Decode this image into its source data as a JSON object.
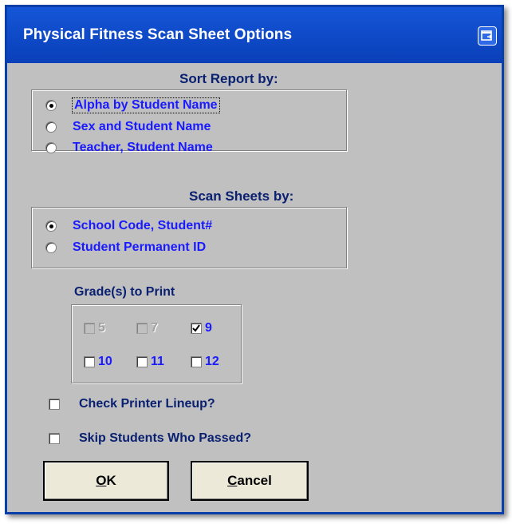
{
  "window": {
    "title": "Physical Fitness Scan Sheet Options"
  },
  "sort_report": {
    "heading": "Sort Report by:",
    "options": [
      {
        "label": "Alpha by Student Name",
        "selected": true
      },
      {
        "label": "Sex and Student Name",
        "selected": false
      },
      {
        "label": "Teacher, Student Name",
        "selected": false
      }
    ]
  },
  "scan_sheets": {
    "heading": "Scan Sheets by:",
    "options": [
      {
        "label": "School Code, Student#",
        "selected": true
      },
      {
        "label": "Student Permanent ID",
        "selected": false
      }
    ]
  },
  "grades": {
    "heading": "Grade(s) to Print",
    "items": [
      {
        "label": "5",
        "checked": false,
        "disabled": true
      },
      {
        "label": "7",
        "checked": false,
        "disabled": true
      },
      {
        "label": "9",
        "checked": true,
        "disabled": false
      },
      {
        "label": "10",
        "checked": false,
        "disabled": false
      },
      {
        "label": "11",
        "checked": false,
        "disabled": false
      },
      {
        "label": "12",
        "checked": false,
        "disabled": false
      }
    ]
  },
  "options": {
    "check_printer_lineup": {
      "label": "Check Printer Lineup?",
      "checked": false
    },
    "skip_passed": {
      "label": "Skip Students Who Passed?",
      "checked": false
    }
  },
  "buttons": {
    "ok": {
      "label_u": "O",
      "label_rest": "K"
    },
    "cancel": {
      "label_u": "C",
      "label_rest": "ancel"
    }
  },
  "colors": {
    "title_bar": "#0a3fb8",
    "option_text": "#1a1aff",
    "heading_text": "#0a2070",
    "dialog_bg": "#c0c0c0"
  }
}
